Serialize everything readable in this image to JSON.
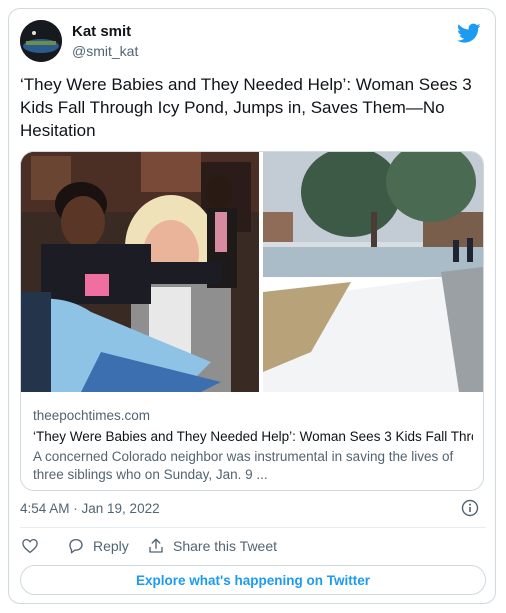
{
  "author": {
    "name": "Kat smit",
    "handle": "@smit_kat"
  },
  "tweet": {
    "text": "‘They Were Babies and They Needed Help’: Woman Sees 3 Kids Fall Through Icy Pond, Jumps in, Saves Them—No Hesitation"
  },
  "link_card": {
    "domain": "theepochtimes.com",
    "title": "‘They Were Babies and They Needed Help’: Woman Sees 3 Kids Fall Thro...",
    "description": "A concerned Colorado neighbor was instrumental in saving the lives of three siblings who on Sunday, Jan. 9 ..."
  },
  "meta": {
    "timestamp": "4:54 AM · Jan 19, 2022"
  },
  "actions": {
    "reply_label": "Reply",
    "share_label": "Share this Tweet"
  },
  "footer": {
    "explore_label": "Explore what's happening on Twitter"
  },
  "icons": {
    "brand": "twitter-bird-icon",
    "like": "heart-icon",
    "reply": "reply-bubble-icon",
    "share": "share-icon",
    "info": "info-icon"
  },
  "colors": {
    "accent": "#1d9bf0",
    "text_primary": "#0f1419",
    "text_secondary": "#536471",
    "border": "#cfd9de"
  }
}
